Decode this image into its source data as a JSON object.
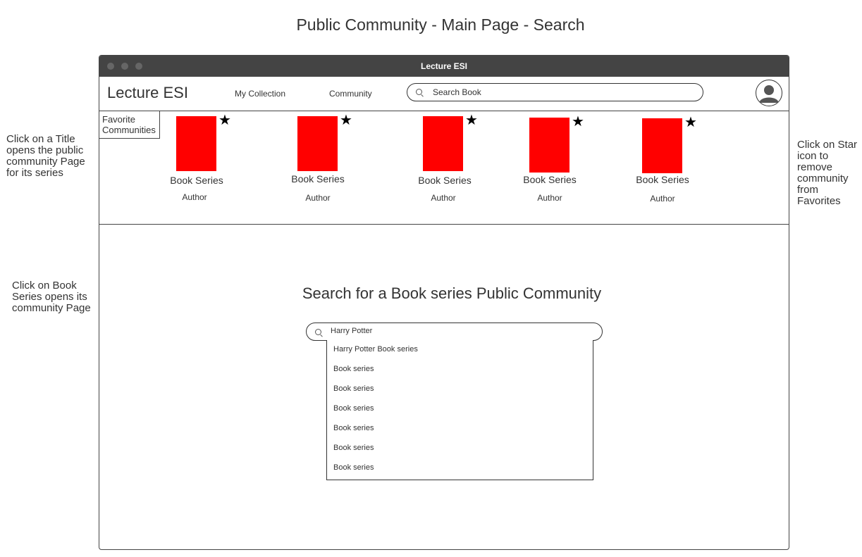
{
  "page_title": "Public Community - Main Page - Search",
  "notes": {
    "left_top": "Click on a Title opens the public community Page for its series",
    "left_mid": "Click on Book Series opens its community Page",
    "right": "Click on Star icon to remove community from Favorites"
  },
  "window": {
    "title": "Lecture ESI"
  },
  "navbar": {
    "brand": "Lecture ESI",
    "my_collection": "My Collection",
    "community": "Community",
    "search_placeholder": "Search Book",
    "search_icon": "search-icon",
    "avatar_icon": "user-avatar-icon"
  },
  "favorites": {
    "label": "Favorite Communities",
    "cover_color": "#ff0000",
    "star_glyph": "★",
    "items": [
      {
        "title": "Book Series",
        "author": "Author"
      },
      {
        "title": "Book Series",
        "author": "Author"
      },
      {
        "title": "Book Series",
        "author": "Author"
      },
      {
        "title": "Book Series",
        "author": "Author"
      },
      {
        "title": "Book Series",
        "author": "Author"
      }
    ]
  },
  "search": {
    "heading": "Search for a Book series  Public Community",
    "value": "Harry Potter",
    "suggestions": [
      "Harry Potter Book series",
      "Book series",
      "Book series",
      "Book series",
      "Book series",
      "Book series",
      "Book series"
    ]
  }
}
